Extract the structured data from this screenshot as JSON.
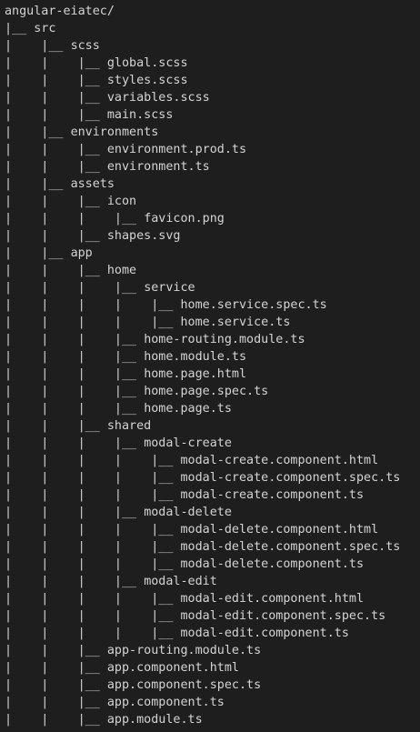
{
  "tree": {
    "lines": [
      {
        "prefix": "",
        "name": "angular-eiatec/"
      },
      {
        "prefix": "|__ ",
        "name": "src"
      },
      {
        "prefix": "|    |__ ",
        "name": "scss"
      },
      {
        "prefix": "|    |    |__ ",
        "name": "global.scss"
      },
      {
        "prefix": "|    |    |__ ",
        "name": "styles.scss"
      },
      {
        "prefix": "|    |    |__ ",
        "name": "variables.scss"
      },
      {
        "prefix": "|    |    |__ ",
        "name": "main.scss"
      },
      {
        "prefix": "|    |__ ",
        "name": "environments"
      },
      {
        "prefix": "|    |    |__ ",
        "name": "environment.prod.ts"
      },
      {
        "prefix": "|    |    |__ ",
        "name": "environment.ts"
      },
      {
        "prefix": "|    |__ ",
        "name": "assets"
      },
      {
        "prefix": "|    |    |__ ",
        "name": "icon"
      },
      {
        "prefix": "|    |    |    |__ ",
        "name": "favicon.png"
      },
      {
        "prefix": "|    |    |__ ",
        "name": "shapes.svg"
      },
      {
        "prefix": "|    |__ ",
        "name": "app"
      },
      {
        "prefix": "|    |    |__ ",
        "name": "home"
      },
      {
        "prefix": "|    |    |    |__ ",
        "name": "service"
      },
      {
        "prefix": "|    |    |    |    |__ ",
        "name": "home.service.spec.ts"
      },
      {
        "prefix": "|    |    |    |    |__ ",
        "name": "home.service.ts"
      },
      {
        "prefix": "|    |    |    |__ ",
        "name": "home-routing.module.ts"
      },
      {
        "prefix": "|    |    |    |__ ",
        "name": "home.module.ts"
      },
      {
        "prefix": "|    |    |    |__ ",
        "name": "home.page.html"
      },
      {
        "prefix": "|    |    |    |__ ",
        "name": "home.page.spec.ts"
      },
      {
        "prefix": "|    |    |    |__ ",
        "name": "home.page.ts"
      },
      {
        "prefix": "|    |    |__ ",
        "name": "shared"
      },
      {
        "prefix": "|    |    |    |__ ",
        "name": "modal-create"
      },
      {
        "prefix": "|    |    |    |    |__ ",
        "name": "modal-create.component.html"
      },
      {
        "prefix": "|    |    |    |    |__ ",
        "name": "modal-create.component.spec.ts"
      },
      {
        "prefix": "|    |    |    |    |__ ",
        "name": "modal-create.component.ts"
      },
      {
        "prefix": "|    |    |    |__ ",
        "name": "modal-delete"
      },
      {
        "prefix": "|    |    |    |    |__ ",
        "name": "modal-delete.component.html"
      },
      {
        "prefix": "|    |    |    |    |__ ",
        "name": "modal-delete.component.spec.ts"
      },
      {
        "prefix": "|    |    |    |    |__ ",
        "name": "modal-delete.component.ts"
      },
      {
        "prefix": "|    |    |    |__ ",
        "name": "modal-edit"
      },
      {
        "prefix": "|    |    |    |    |__ ",
        "name": "modal-edit.component.html"
      },
      {
        "prefix": "|    |    |    |    |__ ",
        "name": "modal-edit.component.spec.ts"
      },
      {
        "prefix": "|    |    |    |    |__ ",
        "name": "modal-edit.component.ts"
      },
      {
        "prefix": "|    |    |__ ",
        "name": "app-routing.module.ts"
      },
      {
        "prefix": "|    |    |__ ",
        "name": "app.component.html"
      },
      {
        "prefix": "|    |    |__ ",
        "name": "app.component.spec.ts"
      },
      {
        "prefix": "|    |    |__ ",
        "name": "app.component.ts"
      },
      {
        "prefix": "|    |    |__ ",
        "name": "app.module.ts"
      }
    ]
  }
}
